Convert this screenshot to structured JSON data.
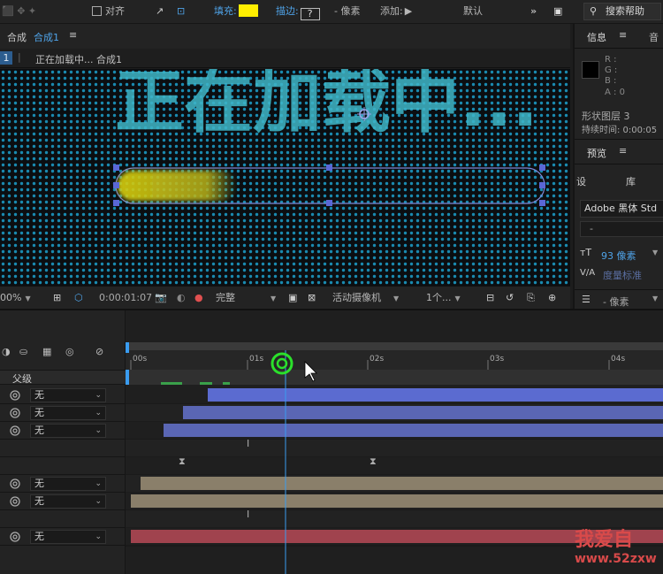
{
  "toolbar": {
    "align_label": "对齐",
    "fill_label": "填充:",
    "stroke_label": "描边:",
    "stroke_value": "?",
    "stroke_unit": "- 像素",
    "add_label": "添加:",
    "workspace_label": "默认",
    "overflow_label": "»",
    "search_label": "搜索帮助",
    "fill_color": "#ffee00"
  },
  "comp": {
    "tab_prefix": "合成",
    "tab_name": "合成1",
    "menu_glyph": "≡",
    "breadcrumb_index": "1",
    "breadcrumb_text": "正在加载中... 合成1",
    "viewer_text": "正在加载中...",
    "footer": {
      "zoom": "00%",
      "timecode": "0:00:01:07",
      "resolution": "完整",
      "camera": "活动摄像机",
      "views": "1个..."
    }
  },
  "info_panel": {
    "title": "信息",
    "menu_glyph": "≡",
    "tab2": "音",
    "r": "R :",
    "g": "G :",
    "b": "B :",
    "a": "A : 0",
    "layer": "形状图层 3",
    "duration": "持续时间: 0:00:05",
    "preview_title": "预览",
    "char_tab1": "设",
    "char_tab2": "库",
    "font": "Adobe 黑体 Std",
    "font_style": "-",
    "size": "93 像素",
    "tracking": "度量标准",
    "stroke_width": "- 像素"
  },
  "timeline": {
    "parent_header": "父级",
    "ruler": [
      "00s",
      "01s",
      "02s",
      "03s",
      "04s"
    ],
    "parent_value": "无",
    "rows": [
      {
        "has_parent": true,
        "bar_color": "#5b6bd0"
      },
      {
        "has_parent": true,
        "bar_color": "#5a66b4"
      },
      {
        "has_parent": true,
        "bar_color": "#5a66b4"
      },
      {
        "has_parent": false,
        "bar_color": ""
      },
      {
        "has_parent": false,
        "bar_color": ""
      },
      {
        "has_parent": true,
        "bar_color": "#8a7f6a"
      },
      {
        "has_parent": true,
        "bar_color": "#8a7f6a"
      },
      {
        "has_parent": false,
        "bar_color": ""
      },
      {
        "has_parent": true,
        "bar_color": "#a0434e"
      }
    ]
  },
  "watermark": {
    "text": "我爱自",
    "url": "www.52zxw"
  },
  "colors": {
    "accent": "#4fa3e8",
    "dot_grid": "#1a8ab0",
    "viewer_text": "#3fb6c8",
    "playhead": "#3a9cf0"
  }
}
